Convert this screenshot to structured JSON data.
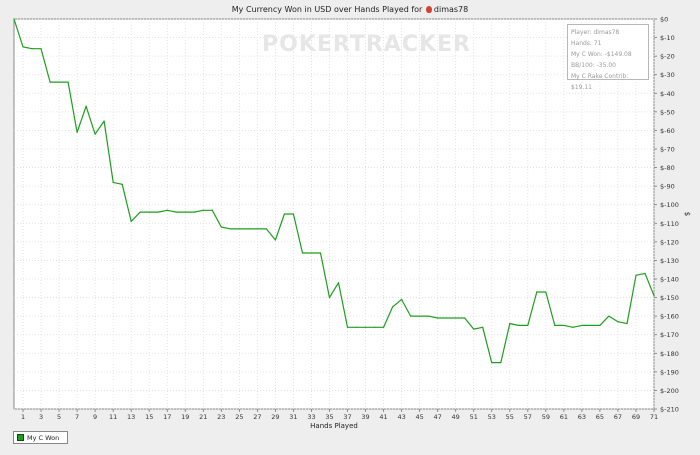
{
  "chart_data": {
    "type": "line",
    "title_prefix": "My Currency Won in USD over Hands Played for",
    "player_name": "dimas78",
    "xlabel": "Hands Played",
    "ylabel": "$",
    "xlim": [
      0,
      71
    ],
    "ylim": [
      -210,
      0
    ],
    "x_ticks": [
      1,
      3,
      5,
      7,
      9,
      11,
      13,
      15,
      17,
      19,
      21,
      23,
      25,
      27,
      29,
      31,
      33,
      35,
      37,
      39,
      41,
      43,
      45,
      47,
      49,
      51,
      53,
      55,
      57,
      59,
      61,
      63,
      65,
      67,
      69,
      71
    ],
    "y_ticks": [
      {
        "value": 0,
        "label": "$0"
      },
      {
        "value": -10,
        "label": "$-10"
      },
      {
        "value": -20,
        "label": "$-20"
      },
      {
        "value": -30,
        "label": "$-30"
      },
      {
        "value": -40,
        "label": "$-40"
      },
      {
        "value": -50,
        "label": "$-50"
      },
      {
        "value": -60,
        "label": "$-60"
      },
      {
        "value": -70,
        "label": "$-70"
      },
      {
        "value": -80,
        "label": "$-80"
      },
      {
        "value": -90,
        "label": "$-90"
      },
      {
        "value": -100,
        "label": "$-100"
      },
      {
        "value": -110,
        "label": "$-110"
      },
      {
        "value": -120,
        "label": "$-120"
      },
      {
        "value": -130,
        "label": "$-130"
      },
      {
        "value": -140,
        "label": "$-140"
      },
      {
        "value": -150,
        "label": "$-150"
      },
      {
        "value": -160,
        "label": "$-160"
      },
      {
        "value": -170,
        "label": "$-170"
      },
      {
        "value": -180,
        "label": "$-180"
      },
      {
        "value": -190,
        "label": "$-190"
      },
      {
        "value": -200,
        "label": "$-200"
      },
      {
        "value": -210,
        "label": "$-210"
      }
    ],
    "grid": true,
    "legend_position": "bottom-left",
    "series": [
      {
        "name": "My C Won",
        "color": "#1e9e1e",
        "x": [
          0,
          1,
          2,
          3,
          4,
          5,
          6,
          7,
          8,
          9,
          10,
          11,
          12,
          13,
          14,
          15,
          16,
          17,
          18,
          19,
          20,
          21,
          22,
          23,
          24,
          25,
          26,
          27,
          28,
          29,
          30,
          31,
          32,
          33,
          34,
          35,
          36,
          37,
          38,
          39,
          40,
          41,
          42,
          43,
          44,
          45,
          46,
          47,
          48,
          49,
          50,
          51,
          52,
          53,
          54,
          55,
          56,
          57,
          58,
          59,
          60,
          61,
          62,
          63,
          64,
          65,
          66,
          67,
          68,
          69,
          70,
          71
        ],
        "y": [
          0,
          -15,
          -16,
          -16,
          -34,
          -34,
          -34,
          -61,
          -47,
          -62,
          -55,
          -88,
          -89,
          -109,
          -104,
          -104,
          -104,
          -103,
          -104,
          -104,
          -104,
          -103,
          -103,
          -112,
          -113,
          -113,
          -113,
          -113,
          -113,
          -119,
          -105,
          -105,
          -126,
          -126,
          -126,
          -150,
          -142,
          -166,
          -166,
          -166,
          -166,
          -166,
          -155,
          -151,
          -160,
          -160,
          -160,
          -161,
          -161,
          -161,
          -161,
          -167,
          -166,
          -185,
          -185,
          -164,
          -165,
          -165,
          -147,
          -147,
          -165,
          -165,
          -166,
          -165,
          -165,
          -165,
          -160,
          -163,
          -164,
          -138,
          -137,
          -149
        ]
      }
    ]
  },
  "info_box": {
    "lines": [
      "Player: dimas78",
      "Hands: 71",
      "My C Won: -$149.08",
      "BB/100: -35.00",
      "My C Rake Contrib: $19.11"
    ]
  },
  "watermark": "POKERTRACKER"
}
